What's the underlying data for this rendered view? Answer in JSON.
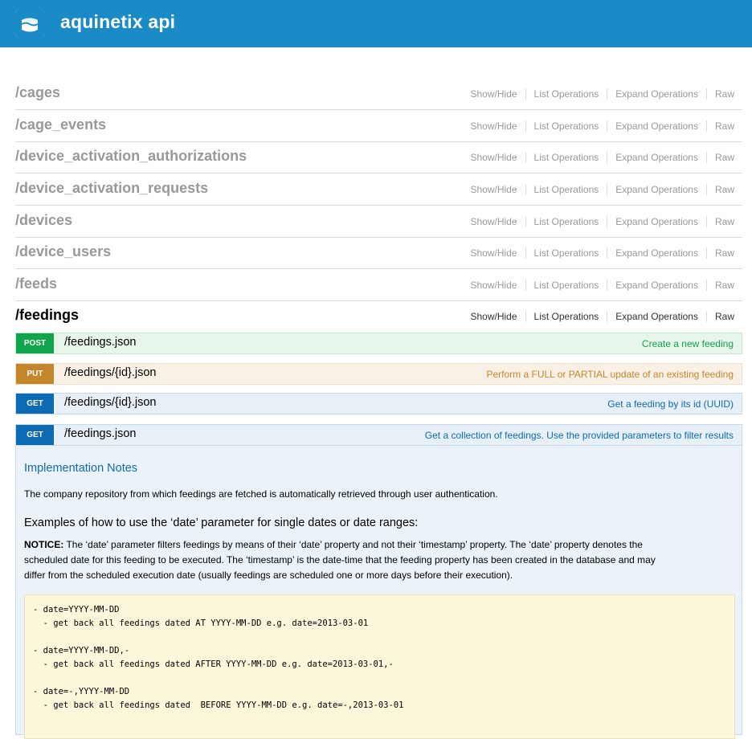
{
  "header": {
    "brand": "aquinetix api",
    "logo_icon": "wave-cube-icon",
    "bg_color": "#1a8bc7"
  },
  "resources": [
    {
      "name": "/cages"
    },
    {
      "name": "/cage_events"
    },
    {
      "name": "/device_activation_authorizations"
    },
    {
      "name": "/device_activation_requests"
    },
    {
      "name": "/devices"
    },
    {
      "name": "/device_users"
    },
    {
      "name": "/feeds"
    },
    {
      "name": "/feedings"
    }
  ],
  "ops": {
    "show_hide": "Show/Hide",
    "list_operations": "List Operations",
    "expand_operations": "Expand Operations",
    "raw": "Raw"
  },
  "endpoints": [
    {
      "method": "POST",
      "path": "/feedings.json",
      "summary": "Create a new feeding",
      "color": "#10a54a"
    },
    {
      "method": "PUT",
      "path": "/feedings/{id}.json",
      "summary": "Perform a FULL or PARTIAL update of an existing feeding",
      "color": "#c5862b"
    },
    {
      "method": "GET",
      "path": "/feedings/{id}.json",
      "summary": "Get a feeding by its id (UUID)",
      "color": "#0f6ab4"
    },
    {
      "method": "GET",
      "path": "/feedings.json",
      "summary": "Get a collection of feedings. Use the provided parameters to filter results",
      "color": "#0f6ab4"
    }
  ],
  "details": {
    "impl_title": "Implementation Notes",
    "impl_text": "The company repository from which feedings are fetched is automatically retrieved through user authentication.",
    "examples_title": "Examples of how to use the ‘date’ parameter for single dates or date ranges:",
    "notice_label": "NOTICE:",
    "notice_line1": "The ‘date’ parameter filters feedings by means of their ‘date’ property and not their ‘timestamp’ property. The ‘date’ property denotes the",
    "notice_line2": "scheduled date for this feeding to be executed. The ‘timestamp’ is the date-time that the feeding property has been created in the database and may",
    "notice_line3": "differ from the scheduled execution date (usually feedings are scheduled one or more days before their execution).",
    "code": [
      {
        "line1": "- date=YYYY-MM-DD",
        "line2": "  - get back all feedings dated AT YYYY-MM-DD e.g. date=2013-03-01"
      },
      {
        "line1": "- date=YYYY-MM-DD,-",
        "line2": "  - get back all feedings dated AFTER YYYY-MM-DD e.g. date=2013-03-01,-"
      },
      {
        "line1": "- date=-,YYYY-MM-DD",
        "line2": "  - get back all feedings dated  BEFORE YYYY-MM-DD e.g. date=-,2013-03-01"
      }
    ]
  }
}
